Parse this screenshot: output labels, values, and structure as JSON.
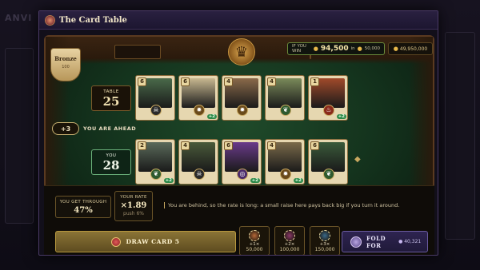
{
  "background": {
    "left_title": "ANVI"
  },
  "modal": {
    "title": "The Card Table"
  },
  "rank_badge": {
    "label": "Bronze",
    "sub": "100"
  },
  "payout": {
    "label": "IF YOU WIN",
    "amount": "94,500",
    "in_label": "in",
    "stake": "50,000",
    "bank": "49,950,000"
  },
  "table_score": {
    "label": "TABLE",
    "value": "25"
  },
  "your_score": {
    "label": "YOU",
    "value": "28"
  },
  "lead": {
    "diff": "+3",
    "text": "YOU ARE AHEAD"
  },
  "table_cards": [
    {
      "rank": "6",
      "suit": "skull",
      "bonus": "",
      "art_color": "#4a6a4a"
    },
    {
      "rank": "6",
      "suit": "sun",
      "bonus": "+2",
      "art_color": "#c8b890"
    },
    {
      "rank": "4",
      "suit": "sun",
      "bonus": "",
      "art_color": "#8a6a4a"
    },
    {
      "rank": "4",
      "suit": "leaf",
      "bonus": "",
      "art_color": "#7a8a5a"
    },
    {
      "rank": "1",
      "suit": "fire",
      "bonus": "+2",
      "art_color": "#a04a2a"
    }
  ],
  "your_cards": [
    {
      "rank": "2",
      "suit": "leaf",
      "bonus": "+2",
      "art_color": "#5a6a5a"
    },
    {
      "rank": "4",
      "suit": "skull",
      "bonus": "",
      "art_color": "#4a5a3a"
    },
    {
      "rank": "6",
      "suit": "swirl",
      "bonus": "+2",
      "art_color": "#6a3a8a"
    },
    {
      "rank": "4",
      "suit": "sun",
      "bonus": "+2",
      "art_color": "#7a6a4a"
    },
    {
      "rank": "6",
      "suit": "leaf",
      "bonus": "",
      "art_color": "#3a5a3a"
    }
  ],
  "stats": {
    "through_label": "YOU GET THROUGH",
    "through_value": "47%",
    "rate_label": "YOUR RATE",
    "rate_value": "×1.89",
    "rate_sub": "push 6%"
  },
  "hint": "You are behind, so the rate is long: a small raise here pays back big if you turn it around.",
  "actions": {
    "draw_label": "DRAW CARD 5",
    "raises": [
      {
        "mult": "+1×",
        "amount": "50,000",
        "chip_color": "#b86a3a"
      },
      {
        "mult": "+2×",
        "amount": "100,000",
        "chip_color": "#8a3a6a"
      },
      {
        "mult": "+3×",
        "amount": "150,000",
        "chip_color": "#3a6a8a"
      }
    ],
    "fold_label_1": "FOLD",
    "fold_label_2": "FOR",
    "fold_amount": "40,321"
  }
}
